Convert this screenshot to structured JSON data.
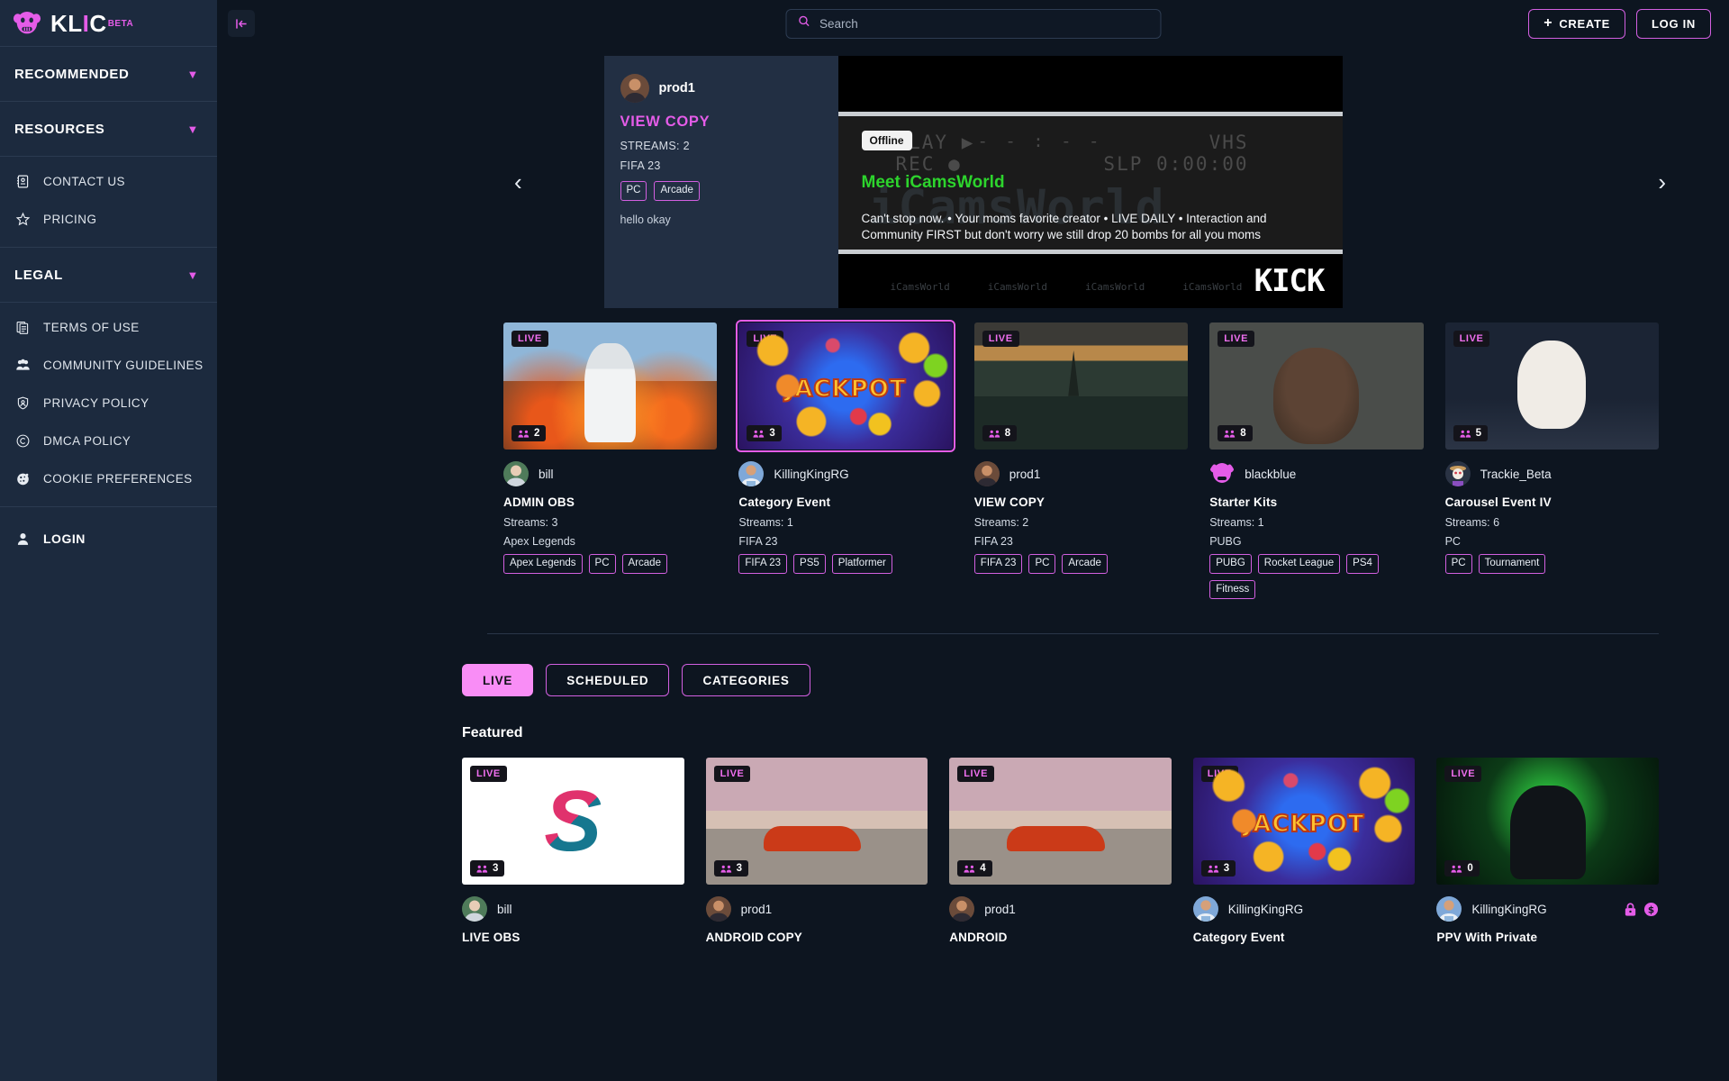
{
  "brand": {
    "name": "KLIC",
    "beta": "BETA"
  },
  "sidebar": {
    "sections": [
      {
        "label": "RECOMMENDED",
        "items": []
      },
      {
        "label": "RESOURCES",
        "items": [
          {
            "label": "CONTACT US",
            "icon": "contact-icon"
          },
          {
            "label": "PRICING",
            "icon": "star-icon"
          }
        ]
      },
      {
        "label": "LEGAL",
        "items": [
          {
            "label": "TERMS OF USE",
            "icon": "document-icon"
          },
          {
            "label": "COMMUNITY GUIDELINES",
            "icon": "people-icon"
          },
          {
            "label": "PRIVACY POLICY",
            "icon": "shield-icon"
          },
          {
            "label": "DMCA POLICY",
            "icon": "copyright-icon"
          },
          {
            "label": "COOKIE PREFERENCES",
            "icon": "cookie-icon"
          }
        ]
      }
    ],
    "login": {
      "label": "LOGIN",
      "icon": "user-icon"
    }
  },
  "topbar": {
    "collapse_icon": "collapse-sidebar-icon",
    "search": {
      "placeholder": "Search",
      "value": "",
      "icon": "search-icon"
    },
    "create_label": "CREATE",
    "create_plus": "+",
    "login_label": "LOG IN"
  },
  "hero": {
    "prev_arrow": "‹",
    "next_arrow": "›",
    "username": "prod1",
    "title": "VIEW COPY",
    "streams": "STREAMS: 2",
    "game": "FIFA 23",
    "tags": [
      "PC",
      "Arcade"
    ],
    "description": "hello okay",
    "media": {
      "offline_badge": "Offline",
      "headline": "Meet iCamsWorld",
      "subtext": "Can't stop now. • Your moms favorite creator • LIVE DAILY • Interaction and Community FIRST but don't worry we still drop 20 bombs for all you moms",
      "osd_play": "PLAY ▶",
      "osd_dash": "- - : - -",
      "osd_rec": "REC ●",
      "osd_vhs": "VHS",
      "osd_slp": "SLP 0:00:00",
      "watermark": "iCamsWorld",
      "socials": [
        "iCamsWorld",
        "iCamsWorld",
        "iCamsWorld",
        "iCamsWorld"
      ],
      "platform": "KICK"
    }
  },
  "carousel_cards": [
    {
      "badge": "LIVE",
      "viewers": "2",
      "username": "bill",
      "title": "ADMIN OBS",
      "streams": "Streams: 3",
      "game": "Apex Legends",
      "tags": [
        "Apex Legends",
        "PC",
        "Arcade"
      ],
      "thumb": "th-pubg",
      "selected": false
    },
    {
      "badge": "LIVE",
      "viewers": "3",
      "username": "KillingKingRG",
      "title": "Category Event",
      "streams": "Streams: 1",
      "game": "FIFA 23",
      "tags": [
        "FIFA 23",
        "PS5",
        "Platformer"
      ],
      "thumb": "th-jackpot",
      "selected": true
    },
    {
      "badge": "LIVE",
      "viewers": "8",
      "username": "prod1",
      "title": "VIEW COPY",
      "streams": "Streams: 2",
      "game": "FIFA 23",
      "tags": [
        "FIFA 23",
        "PC",
        "Arcade"
      ],
      "thumb": "th-lake",
      "selected": false
    },
    {
      "badge": "LIVE",
      "viewers": "8",
      "username": "blackblue",
      "title": "Starter Kits",
      "streams": "Streams: 1",
      "game": "PUBG",
      "tags": [
        "PUBG",
        "Rocket League",
        "PS4",
        "Fitness"
      ],
      "thumb": "th-portrait",
      "selected": false
    },
    {
      "badge": "LIVE",
      "viewers": "5",
      "username": "Trackie_Beta",
      "title": "Carousel Event IV",
      "streams": "Streams: 6",
      "game": "PC",
      "tags": [
        "PC",
        "Tournament"
      ],
      "thumb": "th-anime",
      "selected": false
    }
  ],
  "tabs": [
    {
      "label": "LIVE",
      "active": true
    },
    {
      "label": "SCHEDULED",
      "active": false
    },
    {
      "label": "CATEGORIES",
      "active": false
    }
  ],
  "featured": {
    "title": "Featured",
    "cards": [
      {
        "badge": "LIVE",
        "viewers": "3",
        "username": "bill",
        "title": "LIVE OBS",
        "thumb": "th-slogo",
        "icons": []
      },
      {
        "badge": "LIVE",
        "viewers": "3",
        "username": "prod1",
        "title": "ANDROID COPY",
        "thumb": "th-car",
        "icons": []
      },
      {
        "badge": "LIVE",
        "viewers": "4",
        "username": "prod1",
        "title": "ANDROID",
        "thumb": "th-car",
        "icons": []
      },
      {
        "badge": "LIVE",
        "viewers": "3",
        "username": "KillingKingRG",
        "title": "Category Event",
        "thumb": "th-jackpot",
        "icons": []
      },
      {
        "badge": "LIVE",
        "viewers": "0",
        "username": "KillingKingRG",
        "title": "PPV With Private",
        "thumb": "th-gamer",
        "icons": [
          "lock-icon",
          "dollar-icon"
        ]
      }
    ]
  },
  "colors": {
    "accent": "#e45ce8",
    "accent_soft": "#f98df6",
    "sidebar_bg": "#1c2a3e",
    "page_bg": "#0d1520"
  }
}
